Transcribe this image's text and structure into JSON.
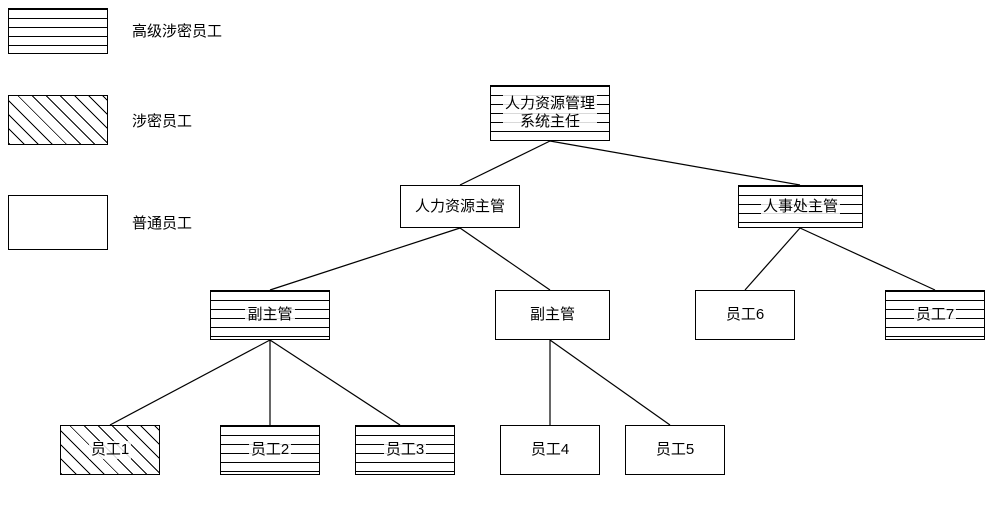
{
  "legend": {
    "senior": "高级涉密员工",
    "secret": "涉密员工",
    "normal": "普通员工"
  },
  "nodes": {
    "root": "人力资源管理\n系统主任",
    "hr_head": "人力资源主管",
    "personnel_head": "人事处主管",
    "deputy_a": "副主管",
    "deputy_b": "副主管",
    "emp1": "员工1",
    "emp2": "员工2",
    "emp3": "员工3",
    "emp4": "员工4",
    "emp5": "员工5",
    "emp6": "员工6",
    "emp7": "员工7"
  },
  "chart_data": {
    "type": "tree",
    "title": "",
    "legend_position": "left",
    "categories": [
      "高级涉密员工",
      "涉密员工",
      "普通员工"
    ],
    "nodes": [
      {
        "id": "root",
        "label": "人力资源管理系统主任",
        "category": "高级涉密员工",
        "parent": null
      },
      {
        "id": "hr_head",
        "label": "人力资源主管",
        "category": "普通员工",
        "parent": "root"
      },
      {
        "id": "personnel_head",
        "label": "人事处主管",
        "category": "高级涉密员工",
        "parent": "root"
      },
      {
        "id": "deputy_a",
        "label": "副主管",
        "category": "高级涉密员工",
        "parent": "hr_head"
      },
      {
        "id": "deputy_b",
        "label": "副主管",
        "category": "普通员工",
        "parent": "hr_head"
      },
      {
        "id": "emp1",
        "label": "员工1",
        "category": "涉密员工",
        "parent": "deputy_a"
      },
      {
        "id": "emp2",
        "label": "员工2",
        "category": "高级涉密员工",
        "parent": "deputy_a"
      },
      {
        "id": "emp3",
        "label": "员工3",
        "category": "高级涉密员工",
        "parent": "deputy_a"
      },
      {
        "id": "emp4",
        "label": "员工4",
        "category": "普通员工",
        "parent": "deputy_b"
      },
      {
        "id": "emp5",
        "label": "员工5",
        "category": "普通员工",
        "parent": "deputy_b"
      },
      {
        "id": "emp6",
        "label": "员工6",
        "category": "普通员工",
        "parent": "personnel_head"
      },
      {
        "id": "emp7",
        "label": "员工7",
        "category": "高级涉密员工",
        "parent": "personnel_head"
      }
    ]
  }
}
